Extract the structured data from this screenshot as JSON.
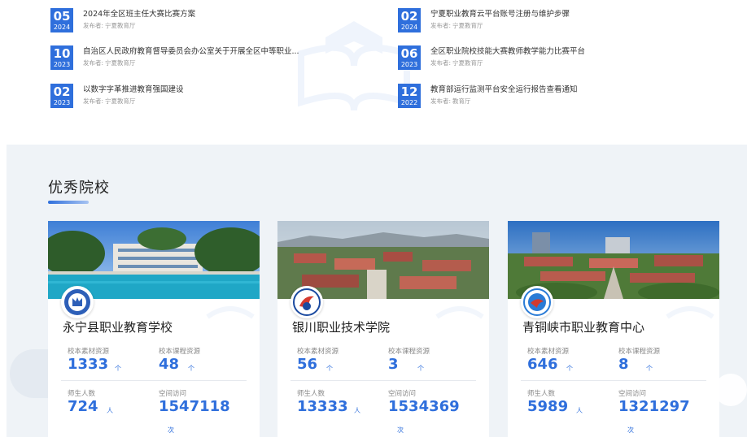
{
  "news": {
    "items": [
      {
        "day": "05",
        "year": "2024",
        "title": "2024年全区班主任大赛比赛方案",
        "publisher_label": "发布者:",
        "publisher": "宁夏教育厅"
      },
      {
        "day": "02",
        "year": "2024",
        "title": "宁夏职业教育云平台账号注册与维护步骤",
        "publisher_label": "发布者:",
        "publisher": "宁夏教育厅"
      },
      {
        "day": "10",
        "year": "2023",
        "title": "自治区人民政府教育督导委员会办公室关于开展全区中等职业...",
        "publisher_label": "发布者:",
        "publisher": "宁夏教育厅"
      },
      {
        "day": "06",
        "year": "2023",
        "title": "全区职业院校技能大赛教师教学能力比赛平台",
        "publisher_label": "发布者:",
        "publisher": "宁夏教育厅"
      },
      {
        "day": "02",
        "year": "2023",
        "title": "以数字字革推进教育强国建设",
        "publisher_label": "发布者:",
        "publisher": "宁夏教育厅"
      },
      {
        "day": "12",
        "year": "2022",
        "title": "教育部运行监测平台安全运行报告查看通知",
        "publisher_label": "发布者:",
        "publisher": "教育厅"
      }
    ]
  },
  "schools": {
    "title": "优秀院校",
    "cards": [
      {
        "name": "永宁县职业教育学校",
        "material_label": "校本素材资源",
        "material_value": "1333",
        "material_unit": "个",
        "course_label": "校本课程资源",
        "course_value": "48",
        "course_unit": "个",
        "people_label": "师生人数",
        "people_value": "724",
        "people_unit": "人",
        "visits_label": "空间访问",
        "visits_value": "1547118",
        "visits_unit": "次"
      },
      {
        "name": "银川职业技术学院",
        "material_label": "校本素材资源",
        "material_value": "56",
        "material_unit": "个",
        "course_label": "校本课程资源",
        "course_value": "3",
        "course_unit": "个",
        "people_label": "师生人数",
        "people_value": "13333",
        "people_unit": "人",
        "visits_label": "空间访问",
        "visits_value": "1534369",
        "visits_unit": "次"
      },
      {
        "name": "青铜峡市职业教育中心",
        "material_label": "校本素材资源",
        "material_value": "646",
        "material_unit": "个",
        "course_label": "校本课程资源",
        "course_value": "8",
        "course_unit": "个",
        "people_label": "师生人数",
        "people_value": "5989",
        "people_unit": "人",
        "visits_label": "空间访问",
        "visits_value": "1321297",
        "visits_unit": "次"
      }
    ]
  },
  "colors": {
    "accent": "#2f6fdc",
    "section_bg": "#eff3f7"
  }
}
